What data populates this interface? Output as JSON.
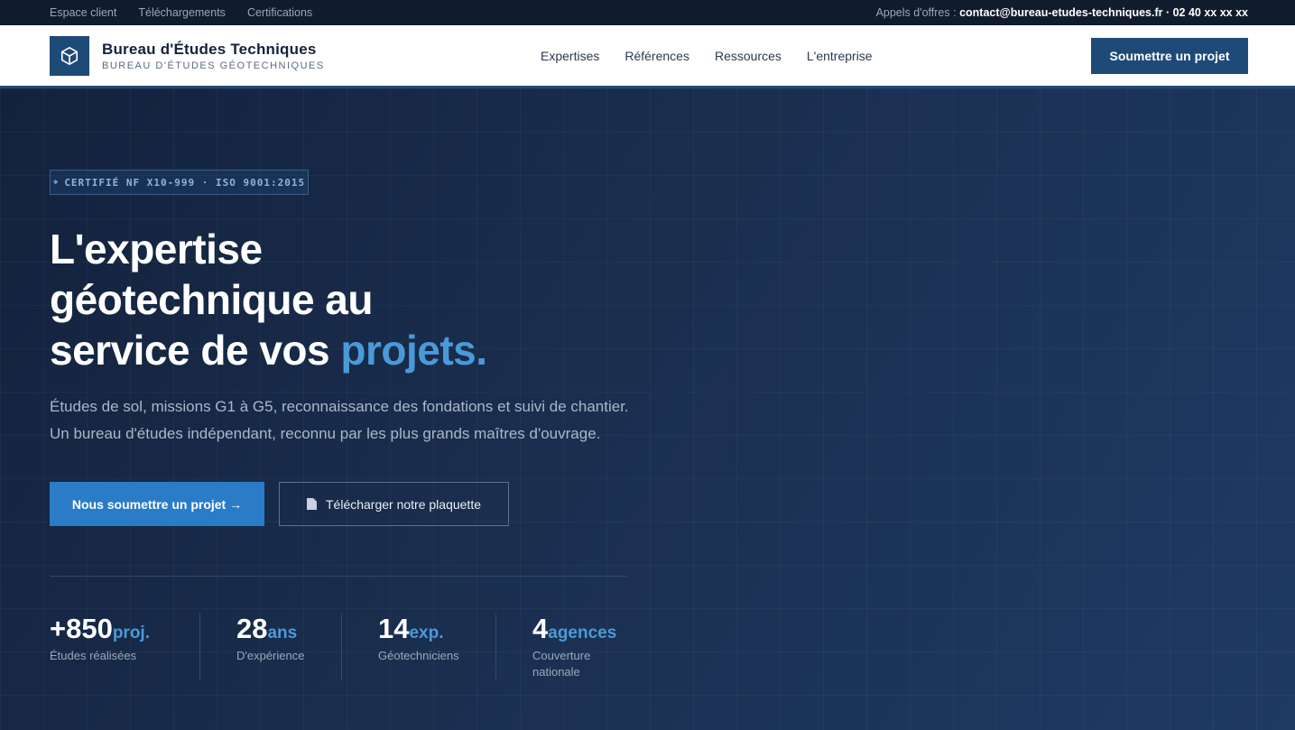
{
  "topbar": {
    "links": [
      "Espace client",
      "Téléchargements",
      "Certifications"
    ],
    "contact_prefix": "Appels d'offres : ",
    "contact_value": "contact@bureau-etudes-techniques.fr · 02 40 xx xx xx"
  },
  "header": {
    "brand_name": "Bureau d'Études Techniques",
    "brand_sub": "BUREAU D'ÉTUDES GÉOTECHNIQUES",
    "nav": [
      "Expertises",
      "Références",
      "Ressources",
      "L'entreprise"
    ],
    "cta": "Soumettre un projet"
  },
  "hero": {
    "badge": "CERTIFIÉ NF X10-999 · ISO 9001:2015",
    "title_line1": "L'expertise",
    "title_line2": "géotechnique au",
    "title_line3_prefix": "service de vos ",
    "title_accent": "projets.",
    "lead": "Études de sol, missions G1 à G5, reconnaissance des fondations et suivi de chantier. Un bureau d'études indépendant, reconnu par les plus grands maîtres d'ouvrage.",
    "primary_button": "Nous soumettre un projet →",
    "secondary_button": "Télécharger notre plaquette"
  },
  "stats": [
    {
      "value": "+850",
      "unit": "proj.",
      "label": "Études réalisées"
    },
    {
      "value": "28",
      "unit": "ans",
      "label": "D'expérience"
    },
    {
      "value": "14",
      "unit": "exp.",
      "label": "Géotechniciens"
    },
    {
      "value": "4",
      "unit": "agences",
      "label": "Couverture nationale"
    }
  ],
  "colors": {
    "brand": "#1e4a78",
    "accent": "#4a9ad9",
    "primary_button": "#2a7cc7"
  },
  "icons": [
    "cube-logo-icon",
    "diamond-icon",
    "document-icon"
  ]
}
